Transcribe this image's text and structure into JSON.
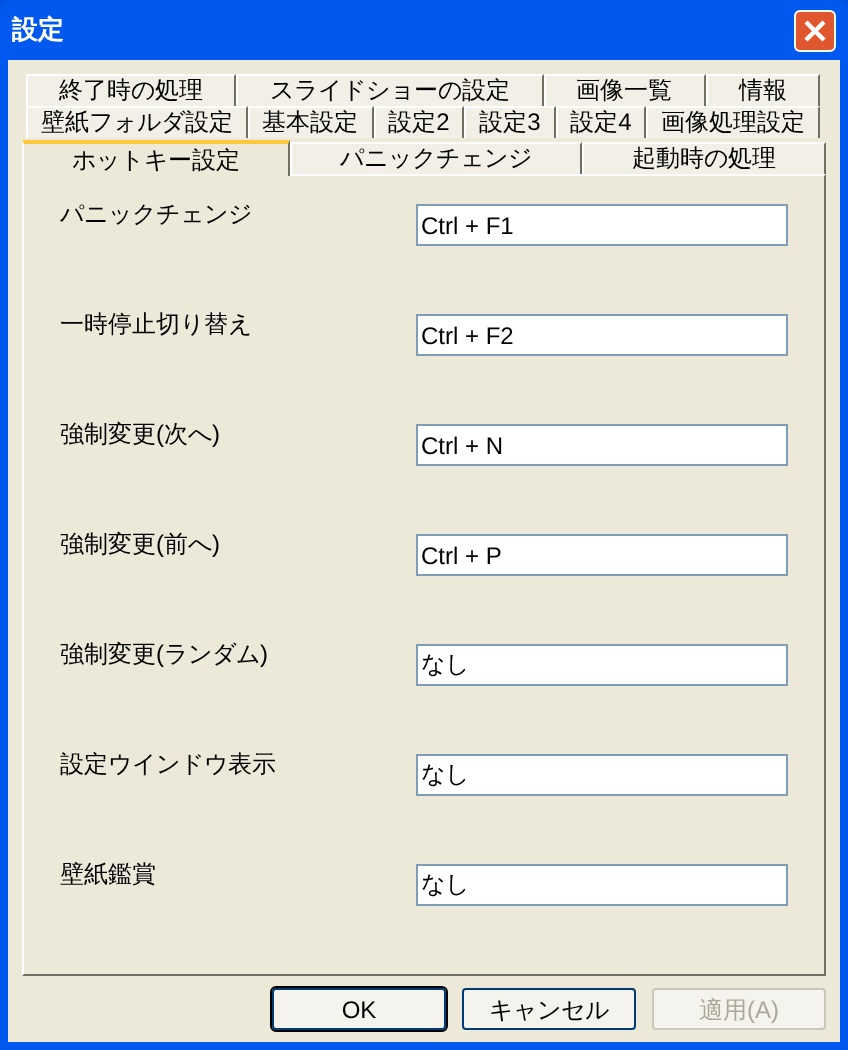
{
  "window": {
    "title": "設定"
  },
  "tab_rows": [
    [
      {
        "label": "終了時の処理",
        "selected": false
      },
      {
        "label": "スライドショーの設定",
        "selected": false
      },
      {
        "label": "画像一覧",
        "selected": false
      },
      {
        "label": "情報",
        "selected": false
      }
    ],
    [
      {
        "label": "壁紙フォルダ設定",
        "selected": false
      },
      {
        "label": "基本設定",
        "selected": false
      },
      {
        "label": "設定2",
        "selected": false
      },
      {
        "label": "設定3",
        "selected": false
      },
      {
        "label": "設定4",
        "selected": false
      },
      {
        "label": "画像処理設定",
        "selected": false
      }
    ],
    [
      {
        "label": "ホットキー設定",
        "selected": true
      },
      {
        "label": "パニックチェンジ",
        "selected": false
      },
      {
        "label": "起動時の処理",
        "selected": false
      }
    ]
  ],
  "hotkeys": [
    {
      "label": "パニックチェンジ",
      "value": "Ctrl + F1"
    },
    {
      "label": "一時停止切り替え",
      "value": "Ctrl + F2"
    },
    {
      "label": "強制変更(次へ)",
      "value": "Ctrl + N"
    },
    {
      "label": "強制変更(前へ)",
      "value": "Ctrl + P"
    },
    {
      "label": "強制変更(ランダム)",
      "value": "なし"
    },
    {
      "label": "設定ウインドウ表示",
      "value": "なし"
    },
    {
      "label": "壁紙鑑賞",
      "value": "なし"
    }
  ],
  "buttons": [
    {
      "label": "OK",
      "disabled": false,
      "default": true
    },
    {
      "label": "キャンセル",
      "disabled": false,
      "default": false
    },
    {
      "label": "適用(A)",
      "disabled": true,
      "default": false
    }
  ]
}
